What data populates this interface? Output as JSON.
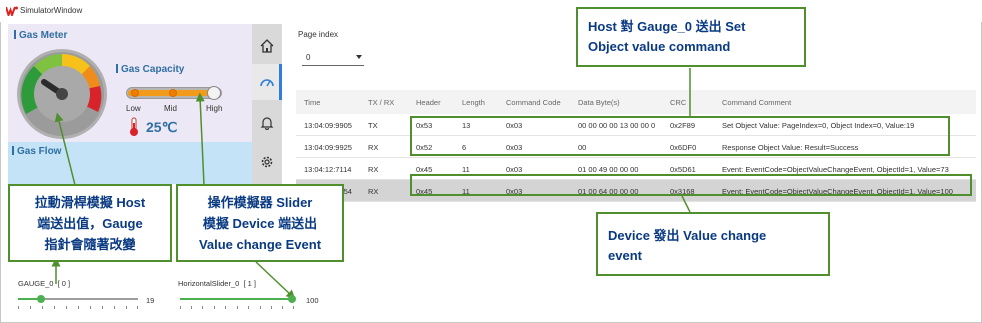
{
  "window": {
    "title": "SimulatorWindow"
  },
  "simulator": {
    "gas_meter_label": "Gas Meter",
    "gas_capacity_label": "Gas Capacity",
    "slider_ticks": [
      "Low",
      "Mid",
      "High"
    ],
    "temperature": "25℃",
    "gas_flow_label": "Gas Flow"
  },
  "sidebar": {
    "items": [
      {
        "icon": "home-icon"
      },
      {
        "icon": "gauge-icon",
        "active": true
      },
      {
        "icon": "bell-icon"
      },
      {
        "icon": "gear-icon"
      }
    ]
  },
  "page_index": {
    "label": "Page index",
    "value": "0"
  },
  "table": {
    "headers": [
      "Time",
      "TX / RX",
      "Header",
      "Length",
      "Command Code",
      "Data Byte(s)",
      "CRC",
      "Command Comment"
    ],
    "rows": [
      [
        "13:04:09:9905",
        "TX",
        "0x53",
        "13",
        "0x03",
        "00 00 00 00 13 00 00 0",
        "0x2F89",
        "Set Object Value: PageIndex=0, Object Index=0, Value:19"
      ],
      [
        "13:04:09:9925",
        "RX",
        "0x52",
        "6",
        "0x03",
        "00",
        "0x6DF0",
        "Response Object Value: Result=Success"
      ],
      [
        "13:04:12:7114",
        "RX",
        "0x45",
        "11",
        "0x03",
        "01 00 49 00 00 00",
        "0x5D61",
        "Event: EventCode=ObjectValueChangeEvent, ObjectId=1, Value=73"
      ],
      [
        "13:04:15:1254",
        "RX",
        "0x45",
        "11",
        "0x03",
        "01 00 64 00 00 00",
        "0x3168",
        "Event: EventCode=ObjectValueChangeEvent, ObjectId=1, Value=100"
      ]
    ],
    "selected_row": 3
  },
  "callouts": {
    "host_set": [
      "Host  對 Gauge_0 送出 Set",
      "Object value command"
    ],
    "drag_slider": [
      "拉動滑桿模擬 Host",
      "端送出值，Gauge",
      "指針會隨著改變"
    ],
    "operate_slider": [
      "操作模擬器 Slider",
      "模擬 Device 端送出",
      "Value change Event"
    ],
    "device_event": [
      "Device  發出  Value change",
      "event"
    ]
  },
  "controls": {
    "gauge": {
      "label": "GAUGE_0",
      "index": "[ 0 ]",
      "value": "19",
      "fraction": 0.19
    },
    "slider": {
      "label": "HorizontalSlider_0",
      "index": "[ 1 ]",
      "value": "100",
      "fraction": 1.0
    }
  },
  "colors": {
    "accent_green": "#4f8f2e",
    "callout_text": "#0a3a82",
    "label_blue": "#2f6fa3",
    "slider_orange": "#ef7d00"
  }
}
